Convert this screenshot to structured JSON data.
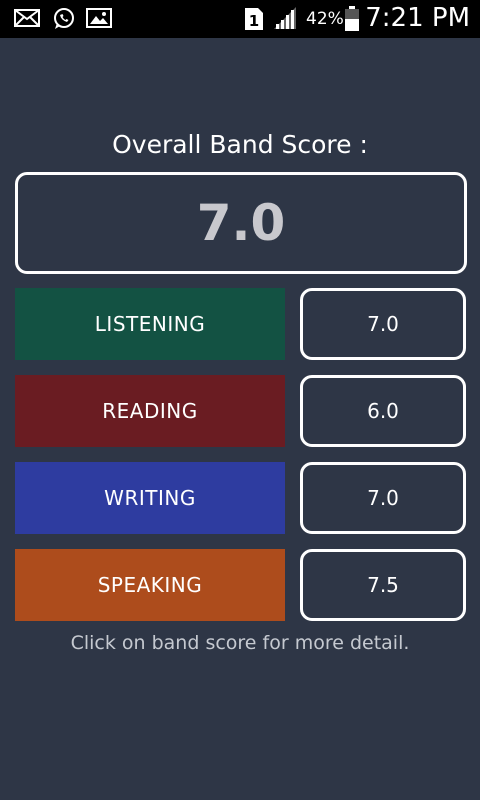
{
  "status_bar": {
    "battery_percent": "42%",
    "time": "7:21 PM",
    "sim_slot": "1",
    "icons": [
      "mail-icon",
      "whatsapp-icon",
      "gallery-icon",
      "sim-icon",
      "signal-icon",
      "battery-icon"
    ]
  },
  "overall": {
    "label": "Overall Band Score :",
    "score": "7.0"
  },
  "skills": [
    {
      "label": "LISTENING",
      "score": "7.0",
      "color": "#135243"
    },
    {
      "label": "READING",
      "score": "6.0",
      "color": "#6a1c22"
    },
    {
      "label": "WRITING",
      "score": "7.0",
      "color": "#2e3ca0"
    },
    {
      "label": "SPEAKING",
      "score": "7.5",
      "color": "#ad4c1c"
    }
  ],
  "hint": "Click on band score for more detail."
}
